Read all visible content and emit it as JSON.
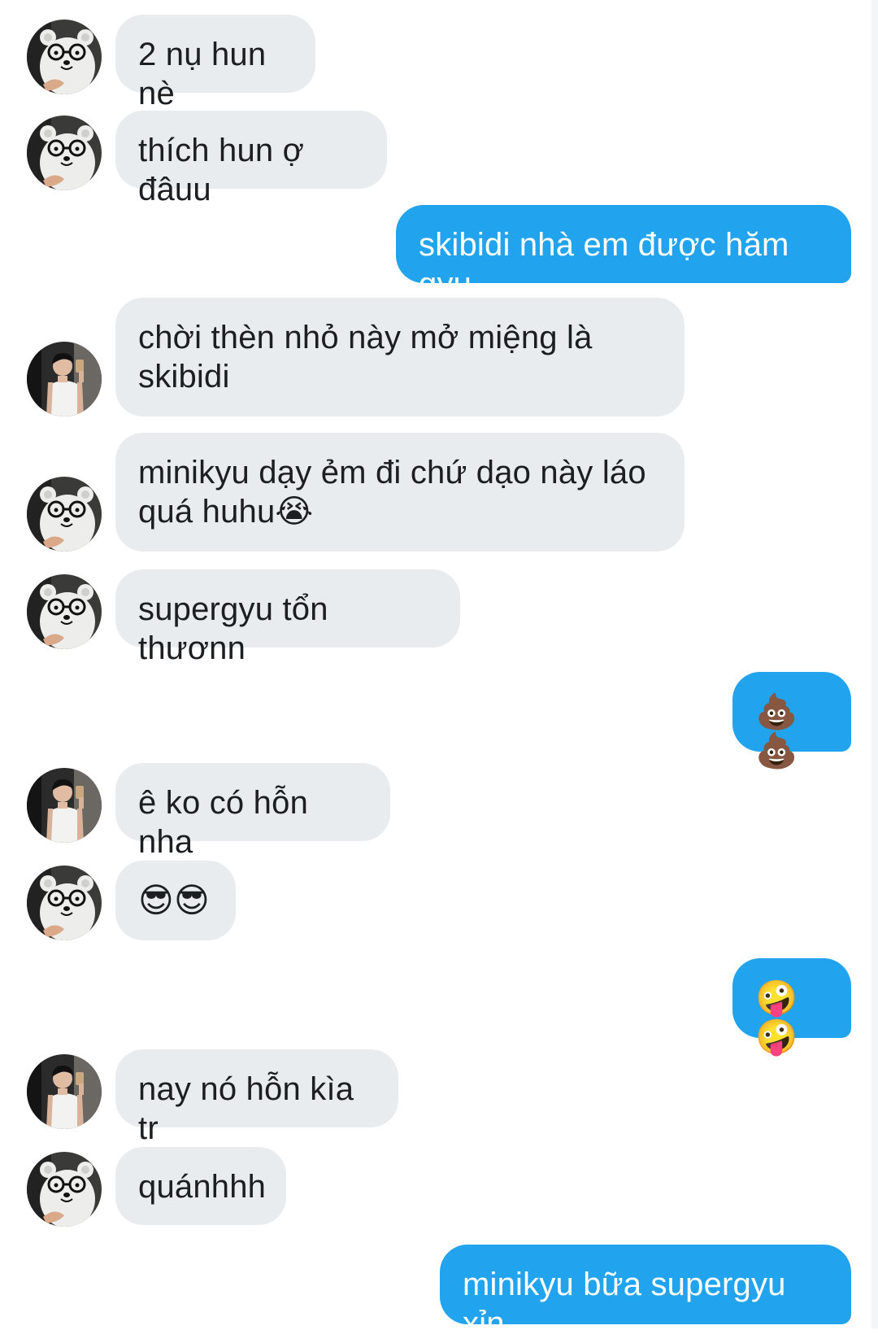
{
  "messages": [
    {
      "side": "in",
      "sender": "bear",
      "text": "2 nụ hun nè"
    },
    {
      "side": "in",
      "sender": "bear",
      "text": "thích hun ợ đâuu"
    },
    {
      "side": "out",
      "text": "skibidi nhà em được hăm gyu"
    },
    {
      "side": "in",
      "sender": "boy",
      "text": "chời thèn nhỏ này mở miệng là\nskibidi"
    },
    {
      "side": "in",
      "sender": "bear",
      "text": "minikyu dạy ẻm đi chứ dạo này láo\nquá huhu😭"
    },
    {
      "side": "in",
      "sender": "bear",
      "text": "supergyu tổn thươnn"
    },
    {
      "side": "out",
      "text": "💩💩"
    },
    {
      "side": "in",
      "sender": "boy",
      "text": "ê ko có hỗn nha"
    },
    {
      "side": "in",
      "sender": "bear",
      "text": "😎😎"
    },
    {
      "side": "out",
      "text": "🤪🤪"
    },
    {
      "side": "in",
      "sender": "boy",
      "text": "nay nó hỗn kìa tr"
    },
    {
      "side": "in",
      "sender": "bear",
      "text": "quánhhh"
    },
    {
      "side": "out",
      "text": "minikyu bữa supergyu xỉn"
    }
  ],
  "colors": {
    "incoming_bubble": "#e9ecef",
    "outgoing_bubble": "#22a3ee",
    "incoming_text": "#1c1e21",
    "outgoing_text": "#ffffff"
  },
  "icons": {
    "bear": "bear-avatar-icon",
    "boy": "boy-avatar-icon"
  }
}
